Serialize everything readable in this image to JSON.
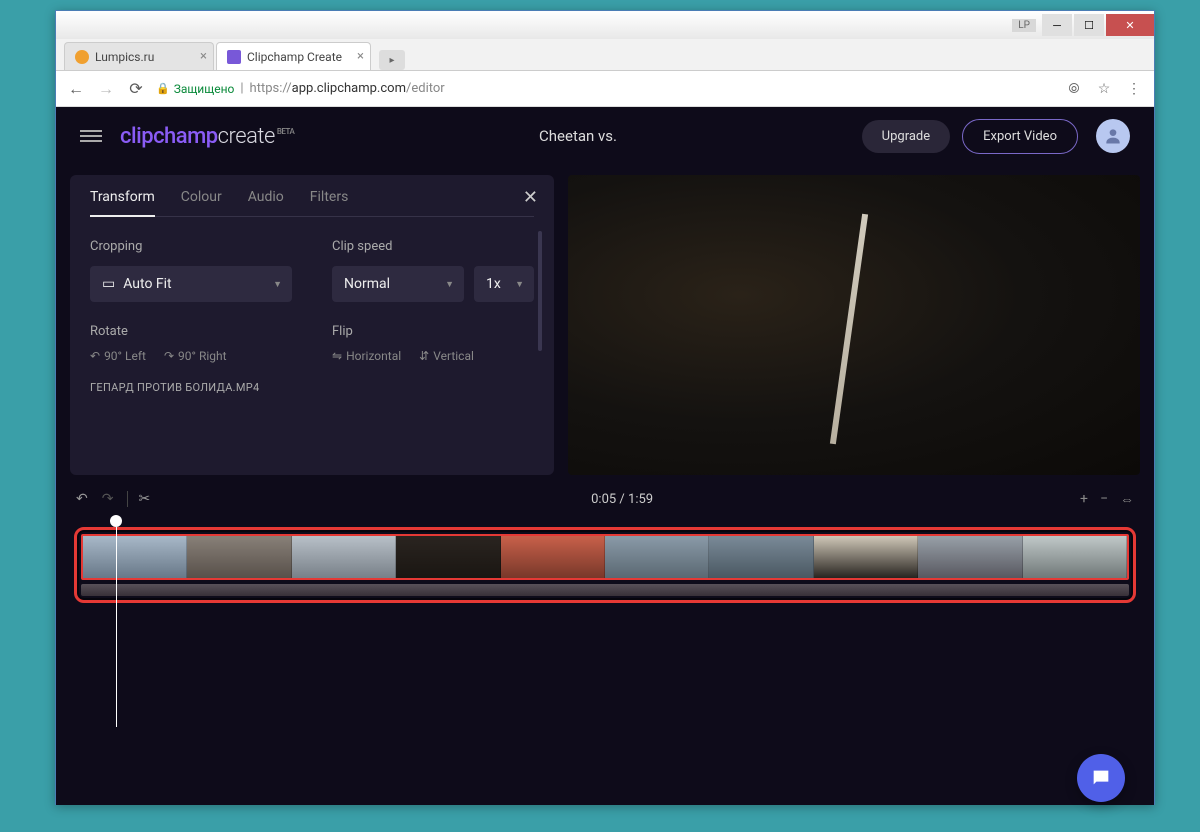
{
  "browser": {
    "titlebar_user": "LP",
    "tabs": [
      {
        "title": "Lumpics.ru",
        "favicon": "#f0a030",
        "active": false
      },
      {
        "title": "Clipchamp Create",
        "favicon": "#7858d8",
        "active": true
      }
    ],
    "url_secure_label": "Защищено",
    "url_proto": "https://",
    "url_host": "app.clipchamp.com",
    "url_path": "/editor"
  },
  "app": {
    "logo_clip": "clipchamp",
    "logo_create": "create",
    "logo_beta": "BETA",
    "project_title": "Cheetan vs.",
    "upgrade_label": "Upgrade",
    "export_label": "Export Video"
  },
  "panel": {
    "tabs": [
      "Transform",
      "Colour",
      "Audio",
      "Filters"
    ],
    "active_tab": 0,
    "cropping_label": "Cropping",
    "cropping_value": "Auto Fit",
    "clipspeed_label": "Clip speed",
    "clipspeed_value": "Normal",
    "clipspeed_mult": "1x",
    "rotate_label": "Rotate",
    "rotate_left": "90° Left",
    "rotate_right": "90° Right",
    "flip_label": "Flip",
    "flip_h": "Horizontal",
    "flip_v": "Vertical",
    "filename": "ГЕПАРД ПРОТИВ БОЛИДА.MP4"
  },
  "timeline": {
    "time_current": "0:05",
    "time_total": "1:59",
    "time_sep": " / "
  }
}
